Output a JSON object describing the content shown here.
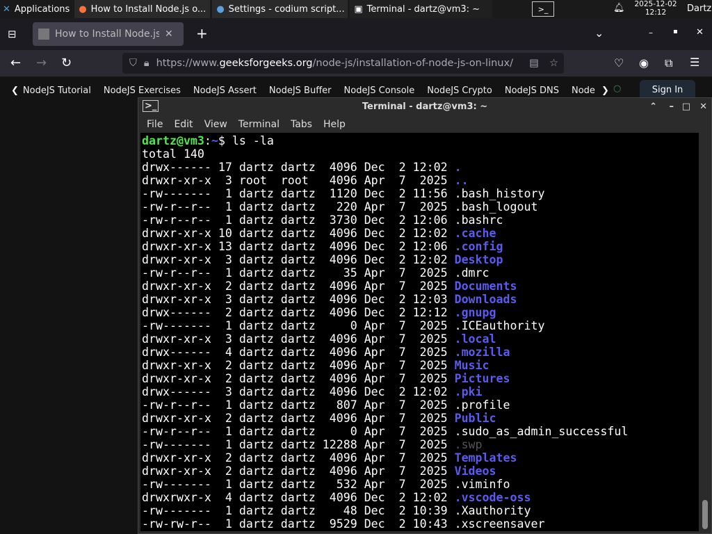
{
  "panel": {
    "apps_label": "Applications",
    "tasks": [
      {
        "label": "How to Install Node.js o...",
        "icon": "firefox-icon"
      },
      {
        "label": "Settings - codium script...",
        "icon": "codium-icon"
      },
      {
        "label": "Terminal - dartz@vm3: ~",
        "icon": "terminal-icon"
      }
    ],
    "date": "2025-12-02",
    "time": "12:12",
    "user": "Dartz"
  },
  "browser": {
    "tab_title": "How to Install Node.js on",
    "url_prefix": "https://www.",
    "url_domain": "geeksforgeeks.org",
    "url_path": "/node-js/installation-of-node-js-on-linux/",
    "bookmarks": [
      "NodeJS Tutorial",
      "NodeJS Exercises",
      "NodeJS Assert",
      "NodeJS Buffer",
      "NodeJS Console",
      "NodeJS Crypto",
      "NodeJS DNS",
      "Node"
    ],
    "sign_in": "Sign In"
  },
  "terminal": {
    "title": "Terminal - dartz@vm3: ~",
    "menu": [
      "File",
      "Edit",
      "View",
      "Terminal",
      "Tabs",
      "Help"
    ],
    "prompt_user": "dartz@vm3",
    "prompt_path": "~",
    "command": "ls -la",
    "total": "total 140",
    "colors": {
      "dir": "#5b5bf0",
      "prompt": "#4ee84e"
    },
    "entries": [
      {
        "meta": "drwx------ 17 dartz dartz  4096 Dec  2 12:02",
        "name": ".",
        "kind": "dir"
      },
      {
        "meta": "drwxr-xr-x  3 root  root   4096 Apr  7  2025",
        "name": "..",
        "kind": "dir"
      },
      {
        "meta": "-rw-------  1 dartz dartz  1120 Dec  2 11:56",
        "name": ".bash_history",
        "kind": "file"
      },
      {
        "meta": "-rw-r--r--  1 dartz dartz   220 Apr  7  2025",
        "name": ".bash_logout",
        "kind": "file"
      },
      {
        "meta": "-rw-r--r--  1 dartz dartz  3730 Dec  2 12:06",
        "name": ".bashrc",
        "kind": "file"
      },
      {
        "meta": "drwxr-xr-x 10 dartz dartz  4096 Dec  2 12:02",
        "name": ".cache",
        "kind": "dir"
      },
      {
        "meta": "drwxr-xr-x 13 dartz dartz  4096 Dec  2 12:06",
        "name": ".config",
        "kind": "dir"
      },
      {
        "meta": "drwxr-xr-x  3 dartz dartz  4096 Dec  2 12:02",
        "name": "Desktop",
        "kind": "dir"
      },
      {
        "meta": "-rw-r--r--  1 dartz dartz    35 Apr  7  2025",
        "name": ".dmrc",
        "kind": "file"
      },
      {
        "meta": "drwxr-xr-x  2 dartz dartz  4096 Apr  7  2025",
        "name": "Documents",
        "kind": "dir"
      },
      {
        "meta": "drwxr-xr-x  3 dartz dartz  4096 Dec  2 12:03",
        "name": "Downloads",
        "kind": "dir"
      },
      {
        "meta": "drwx------  2 dartz dartz  4096 Dec  2 12:12",
        "name": ".gnupg",
        "kind": "dir"
      },
      {
        "meta": "-rw-------  1 dartz dartz     0 Apr  7  2025",
        "name": ".ICEauthority",
        "kind": "file"
      },
      {
        "meta": "drwxr-xr-x  3 dartz dartz  4096 Apr  7  2025",
        "name": ".local",
        "kind": "dir"
      },
      {
        "meta": "drwx------  4 dartz dartz  4096 Apr  7  2025",
        "name": ".mozilla",
        "kind": "dir"
      },
      {
        "meta": "drwxr-xr-x  2 dartz dartz  4096 Apr  7  2025",
        "name": "Music",
        "kind": "dir"
      },
      {
        "meta": "drwxr-xr-x  2 dartz dartz  4096 Apr  7  2025",
        "name": "Pictures",
        "kind": "dir"
      },
      {
        "meta": "drwx------  3 dartz dartz  4096 Dec  2 12:02",
        "name": ".pki",
        "kind": "dir"
      },
      {
        "meta": "-rw-r--r--  1 dartz dartz   807 Apr  7  2025",
        "name": ".profile",
        "kind": "file"
      },
      {
        "meta": "drwxr-xr-x  2 dartz dartz  4096 Apr  7  2025",
        "name": "Public",
        "kind": "dir"
      },
      {
        "meta": "-rw-r--r--  1 dartz dartz     0 Apr  7  2025",
        "name": ".sudo_as_admin_successful",
        "kind": "file"
      },
      {
        "meta": "-rw-------  1 dartz dartz 12288 Apr  7  2025",
        "name": ".swp",
        "kind": "dim"
      },
      {
        "meta": "drwxr-xr-x  2 dartz dartz  4096 Apr  7  2025",
        "name": "Templates",
        "kind": "dir"
      },
      {
        "meta": "drwxr-xr-x  2 dartz dartz  4096 Apr  7  2025",
        "name": "Videos",
        "kind": "dir"
      },
      {
        "meta": "-rw-------  1 dartz dartz   532 Apr  7  2025",
        "name": ".viminfo",
        "kind": "file"
      },
      {
        "meta": "drwxrwxr-x  4 dartz dartz  4096 Dec  2 12:02",
        "name": ".vscode-oss",
        "kind": "dir"
      },
      {
        "meta": "-rw-------  1 dartz dartz    48 Dec  2 10:39",
        "name": ".Xauthority",
        "kind": "file"
      },
      {
        "meta": "-rw-rw-r--  1 dartz dartz  9529 Dec  2 10:43",
        "name": ".xscreensaver",
        "kind": "file"
      }
    ]
  }
}
